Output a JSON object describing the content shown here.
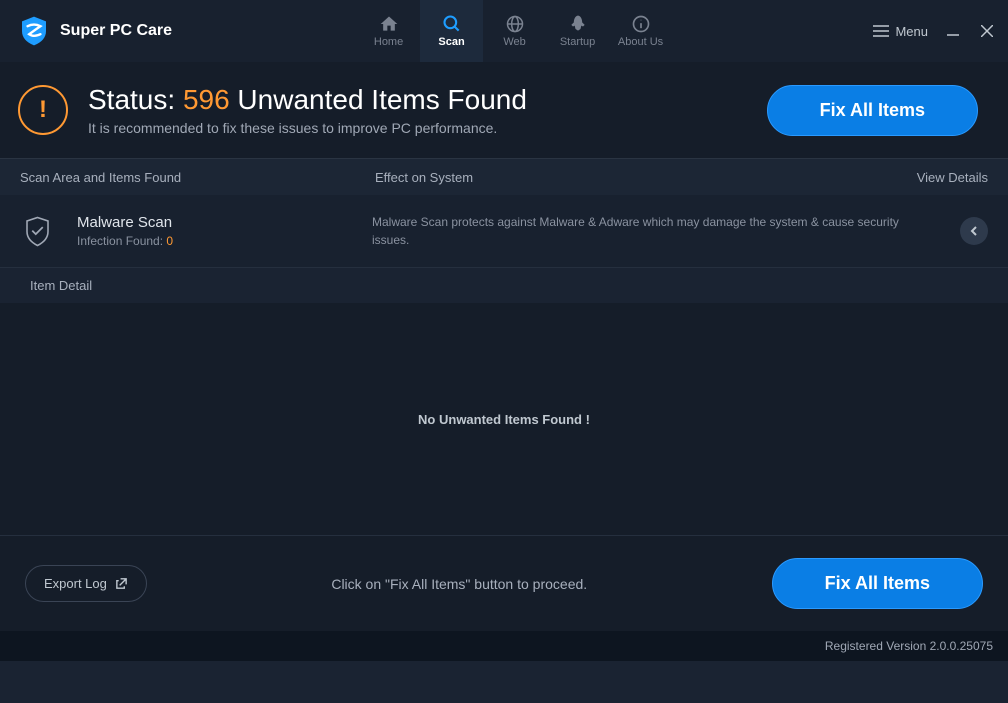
{
  "app": {
    "title": "Super PC Care"
  },
  "nav": {
    "tabs": [
      {
        "label": "Home"
      },
      {
        "label": "Scan"
      },
      {
        "label": "Web"
      },
      {
        "label": "Startup"
      },
      {
        "label": "About Us"
      }
    ]
  },
  "menu_label": "Menu",
  "status": {
    "prefix": "Status: ",
    "count": "596",
    "suffix": " Unwanted Items Found",
    "subtitle": "It is recommended to fix these issues to improve PC performance.",
    "fix_button": "Fix All Items"
  },
  "table_header": {
    "scan_area": "Scan Area and Items Found",
    "effect": "Effect on System",
    "view_details": "View Details"
  },
  "scan_category": {
    "title": "Malware Scan",
    "detail_label": "Infection Found: ",
    "detail_count": "0",
    "description": "Malware Scan protects against Malware & Adware which may damage the system & cause security issues."
  },
  "item_detail_label": "Item Detail",
  "empty_message": "No Unwanted Items Found !",
  "footer": {
    "export_label": "Export Log",
    "hint": "Click on \"Fix All Items\" button to proceed.",
    "fix_button": "Fix All Items"
  },
  "status_bar": {
    "version": "Registered Version 2.0.0.25075"
  }
}
